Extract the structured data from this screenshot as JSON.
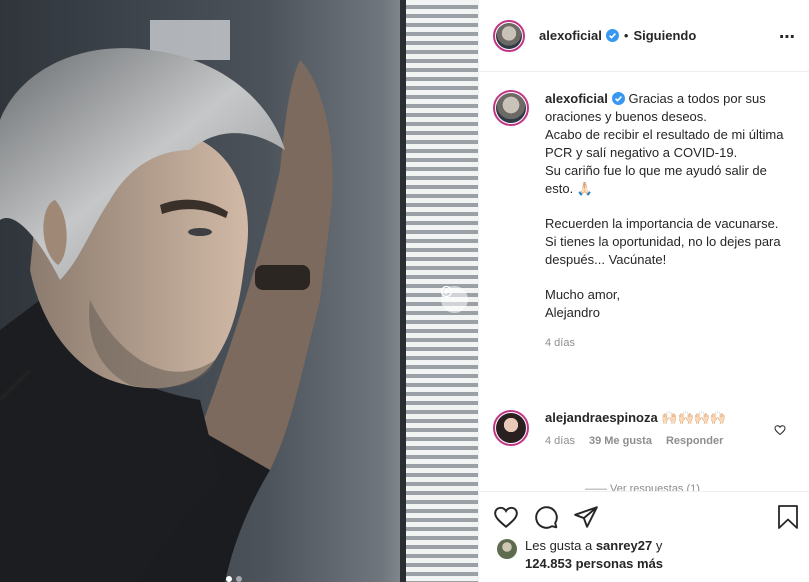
{
  "post": {
    "username": "alexoficial",
    "follow_state": "Siguiendo",
    "separator": "•",
    "more_icon": "⋯"
  },
  "caption": {
    "username": "alexoficial",
    "lines": [
      "Gracias a todos por sus oraciones y buenos deseos.",
      "Acabo de recibir el resultado de mi última PCR y salí negativo a COVID-19.",
      "Su cariño fue lo que me ayudó salir de esto. 🙏🏻"
    ],
    "lines2": [
      "Recuerden la importancia de vacunarse.",
      "Si tienes la oportunidad, no lo dejes para después... Vacúnate!"
    ],
    "lines3": [
      "Mucho amor,",
      "Alejandro"
    ],
    "time": "4 días"
  },
  "comment": {
    "username": "alejandraespinoza",
    "text": "🙌🏻🙌🏻🙌🏻🙌🏻",
    "time": "4 días",
    "likes": "39 Me gusta",
    "reply": "Responder",
    "more_replies": "—— Ver respuestas (1)"
  },
  "likes": {
    "prefix": "Les gusta a ",
    "user": "sanrey27",
    "middle": " y",
    "count": "124.853 personas más"
  },
  "icons": {
    "verified": "verified-badge-icon",
    "like": "heart-icon",
    "comment": "comment-icon",
    "share": "paper-plane-icon",
    "save": "bookmark-icon",
    "next": "chevron-right-icon"
  },
  "colors": {
    "verified": "#3897f0",
    "avatar_ring": "#c13584",
    "text": "#262626",
    "secondary": "#8e8e8e",
    "border": "#efefef"
  }
}
